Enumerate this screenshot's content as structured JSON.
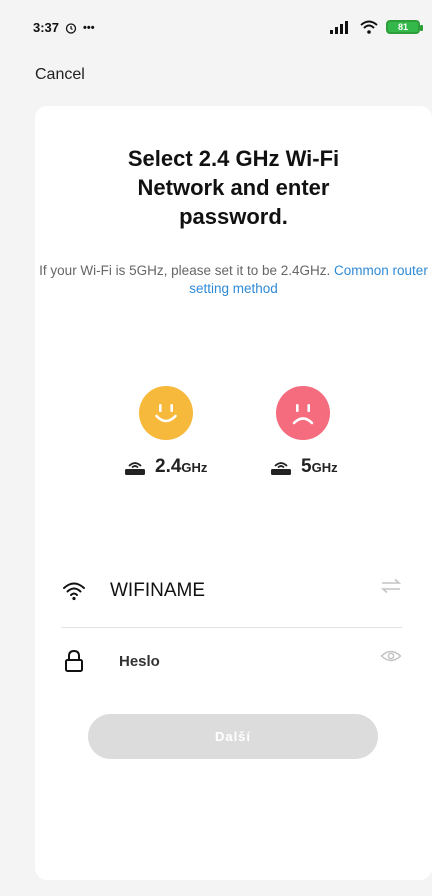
{
  "status_bar": {
    "time": "3:37",
    "overflow_dots": "•••",
    "battery_level": "81"
  },
  "header": {
    "cancel_label": "Cancel"
  },
  "card": {
    "title_line1": "Select 2.4 GHz Wi-Fi",
    "title_line2": "Network and enter",
    "title_line3": "password.",
    "hint_text": "If your Wi-Fi is 5GHz, please set it to be 2.4GHz.",
    "hint_link": "Common router setting method",
    "band_24": {
      "number": "2.4",
      "unit": "GHz"
    },
    "band_5": {
      "number": "5",
      "unit": "GHz"
    },
    "wifi_name": "WIFINAME",
    "password_placeholder": "Heslo",
    "next_button_label": "Další"
  },
  "colors": {
    "happy_face": "#f6b93b",
    "sad_face": "#f46c7e",
    "link": "#2f8ad6",
    "button_disabled": "#dcdcdc",
    "battery": "#35b84a"
  },
  "icons": [
    "wifi-icon",
    "lock-icon",
    "swap-icon",
    "eye-icon",
    "router-icon",
    "signal-icon",
    "alarm-icon"
  ]
}
